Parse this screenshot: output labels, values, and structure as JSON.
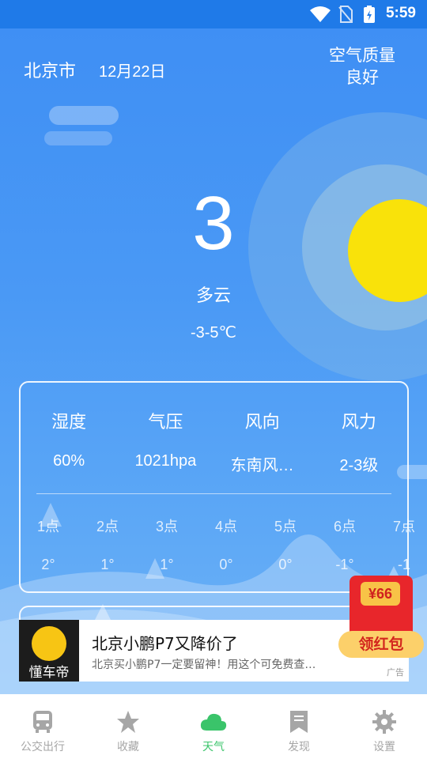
{
  "status_bar": {
    "time": "5:59"
  },
  "location": {
    "city": "北京市",
    "date": "12月22日"
  },
  "air_quality": {
    "label": "空气质量",
    "level": "良好"
  },
  "current": {
    "temperature": "3",
    "condition": "多云",
    "range": "-3-5℃"
  },
  "details": {
    "headers": [
      "湿度",
      "气压",
      "风向",
      "风力"
    ],
    "values": [
      "60%",
      "1021hpa",
      "东南风…",
      "2-3级"
    ]
  },
  "hourly": [
    {
      "hour": "1点",
      "temp": "2°"
    },
    {
      "hour": "2点",
      "temp": "1°"
    },
    {
      "hour": "3点",
      "temp": "1°"
    },
    {
      "hour": "4点",
      "temp": "0°"
    },
    {
      "hour": "5点",
      "temp": "0°"
    },
    {
      "hour": "6点",
      "temp": "-1°"
    },
    {
      "hour": "7点",
      "temp": "-1"
    }
  ],
  "ad": {
    "brand": "懂车帝",
    "title": "北京小鹏P7又降价了",
    "description": "北京买小鹏P7一定要留神！用这个可免费查…",
    "tag": "广告"
  },
  "red_packet": {
    "amount": "¥66",
    "button": "领红包"
  },
  "tabs": [
    {
      "label": "公交出行",
      "icon": "bus-icon",
      "active": false
    },
    {
      "label": "收藏",
      "icon": "star-icon",
      "active": false
    },
    {
      "label": "天气",
      "icon": "cloud-icon",
      "active": true
    },
    {
      "label": "发现",
      "icon": "bookmark-icon",
      "active": false
    },
    {
      "label": "设置",
      "icon": "gear-icon",
      "active": false
    }
  ],
  "colors": {
    "accent": "#3ac46a",
    "sky": "#3d8bf2",
    "sun": "#f9e20a"
  }
}
